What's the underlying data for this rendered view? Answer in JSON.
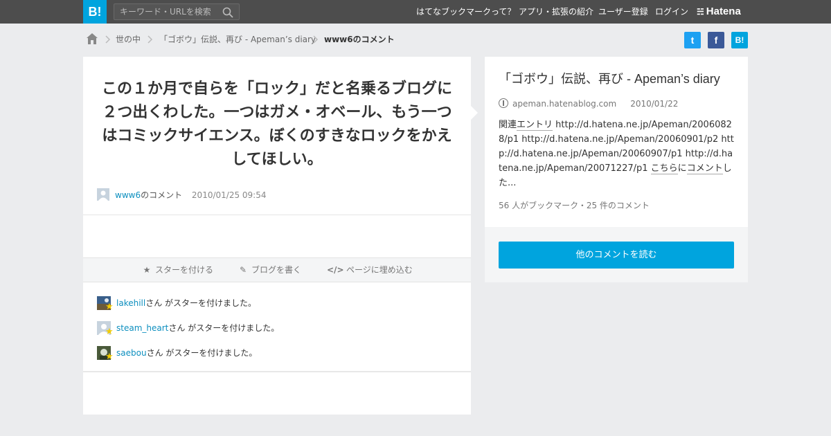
{
  "header": {
    "logo": "B!",
    "search_placeholder": "キーワード・URLを検索",
    "nav": [
      "はてなブックマークって？",
      "アプリ・拡張の紹介",
      "ユーザー登録",
      "ログイン"
    ],
    "brand": "Hatena"
  },
  "breadcrumb": {
    "items": [
      "世の中",
      "「ゴボウ」伝説、再び - Apeman’s diary",
      "www6のコメント"
    ]
  },
  "share": {
    "twitter": "t",
    "facebook": "f",
    "hatena": "B!"
  },
  "comment": {
    "text": "この１か月で自らを「ロック」だと名乗るブログに２つ出くわした。一つはガメ・オベール、もう一つはコミックサイエンス。ぼくのすきなロックをかえしてほしい。",
    "user": "www6",
    "user_suffix": "のコメント",
    "datetime": "2010/01/25 09:54"
  },
  "actions": {
    "star": "スターを付ける",
    "blog": "ブログを書く",
    "embed": "ページに埋め込む"
  },
  "stars": [
    {
      "user": "lakehill",
      "text": "さん がスターを付けました。"
    },
    {
      "user": "steam_heart",
      "text": "さん がスターを付けました。"
    },
    {
      "user": "saebou",
      "text": "さん がスターを付けました。"
    }
  ],
  "entry": {
    "title": "「ゴボウ」伝説、再び - Apeman’s diary",
    "domain": "apeman.hatenablog.com",
    "date": "2010/01/22",
    "excerpt_prefix": "関連",
    "excerpt_link1": "エントリ",
    "excerpt_body": " http://d.hatena.ne.jp/Apeman/20060828/p1 http://d.hatena.ne.jp/Apeman/20060901/p2 http://d.hatena.ne.jp/Apeman/20060907/p1 http://d.hatena.ne.jp/Apeman/20071227/p1 ",
    "excerpt_link2": "こちら",
    "excerpt_mid": "に",
    "excerpt_link3": "コメント",
    "excerpt_tail": "した...",
    "stats": "56 人がブックマーク・25 件のコメント",
    "read_button": "他のコメントを読む"
  },
  "colors": {
    "topbar": "#4d4d4d",
    "accent": "#00a4de",
    "link": "#0d8fbf",
    "star": "#f2cc00"
  }
}
